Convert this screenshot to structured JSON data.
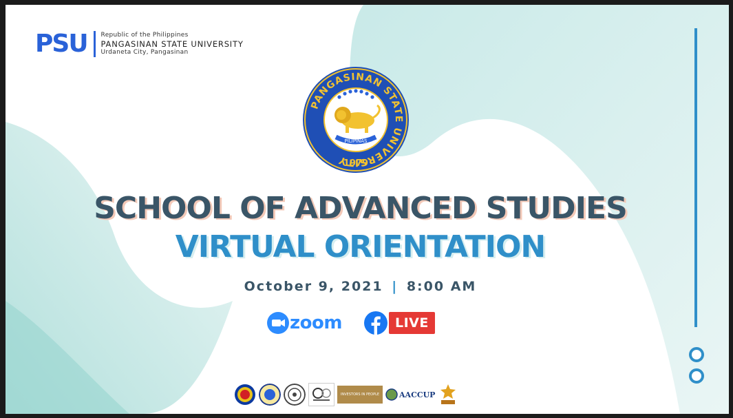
{
  "header": {
    "logo_text": "PSU",
    "line1": "Republic of the Philippines",
    "line2": "PANGASINAN STATE UNIVERSITY",
    "line3": "Urdaneta City, Pangasinan"
  },
  "seal": {
    "ring_text": "PANGASINAN STATE UNIVERSITY",
    "country": "PILIPINAS",
    "year": "1979"
  },
  "title": {
    "main": "SCHOOL OF ADVANCED STUDIES",
    "sub": "VIRTUAL ORIENTATION"
  },
  "schedule": {
    "date": "October 9, 2021",
    "separator": "|",
    "time": "8:00 AM"
  },
  "platforms": {
    "zoom_label": "zoom",
    "live_label": "LIVE"
  },
  "accreditations": {
    "aaccup_label": "AACCUP",
    "iip_label": "INVESTORS IN PEOPLE",
    "prime_label": "PRIME"
  },
  "colors": {
    "title_dark": "#3a5567",
    "accent_blue": "#2f8fc9",
    "seal_blue": "#1f4fb5",
    "seal_gold": "#f2c230",
    "live_red": "#e53935",
    "zoom_blue": "#2d8cff",
    "facebook_blue": "#1877f2"
  },
  "icons": {
    "zoom": "zoom-camera-icon",
    "facebook": "facebook-icon",
    "decor_dots": "circle-ring-icon"
  }
}
